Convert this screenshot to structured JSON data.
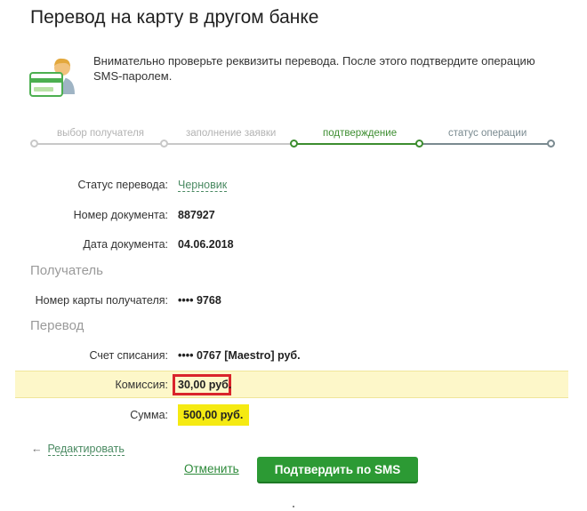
{
  "header": {
    "title": "Перевод на карту в другом банке"
  },
  "intro": {
    "icon": "user-card-icon",
    "text": "Внимательно проверьте реквизиты перевода. После этого подтвердите операцию SMS-паролем."
  },
  "stepper": {
    "steps": [
      {
        "label": "выбор получателя",
        "state": "done"
      },
      {
        "label": "заполнение заявки",
        "state": "done"
      },
      {
        "label": "подтверждение",
        "state": "active"
      },
      {
        "label": "статус операции",
        "state": "future"
      }
    ],
    "colors": {
      "done": "#c8c8c8",
      "active": "#3c8d2f",
      "future": "#7a8a90"
    }
  },
  "details": {
    "status_label": "Статус перевода:",
    "status_value": "Черновик",
    "doc_number_label": "Номер документа:",
    "doc_number_value": "887927",
    "doc_date_label": "Дата документа:",
    "doc_date_value": "04.06.2018"
  },
  "recipient": {
    "heading": "Получатель",
    "card_label": "Номер карты получателя:",
    "card_value": "•••• 9768"
  },
  "transfer": {
    "heading": "Перевод",
    "account_label": "Счет списания:",
    "account_value": "•••• 0767  [Maestro]  руб.",
    "commission_label": "Комиссия:",
    "commission_value": "30,00 руб.",
    "sum_label": "Сумма:",
    "sum_value": "500,00  руб."
  },
  "actions": {
    "edit_label": "Редактировать",
    "cancel_label": "Отменить",
    "confirm_label": "Подтвердить по SMS"
  },
  "colors": {
    "accent_green": "#2c9a34",
    "link_green": "#4a8a62",
    "highlight_yellow": "#f5ea12",
    "commission_band": "#fdf7c9",
    "commission_border": "#d9242b"
  }
}
